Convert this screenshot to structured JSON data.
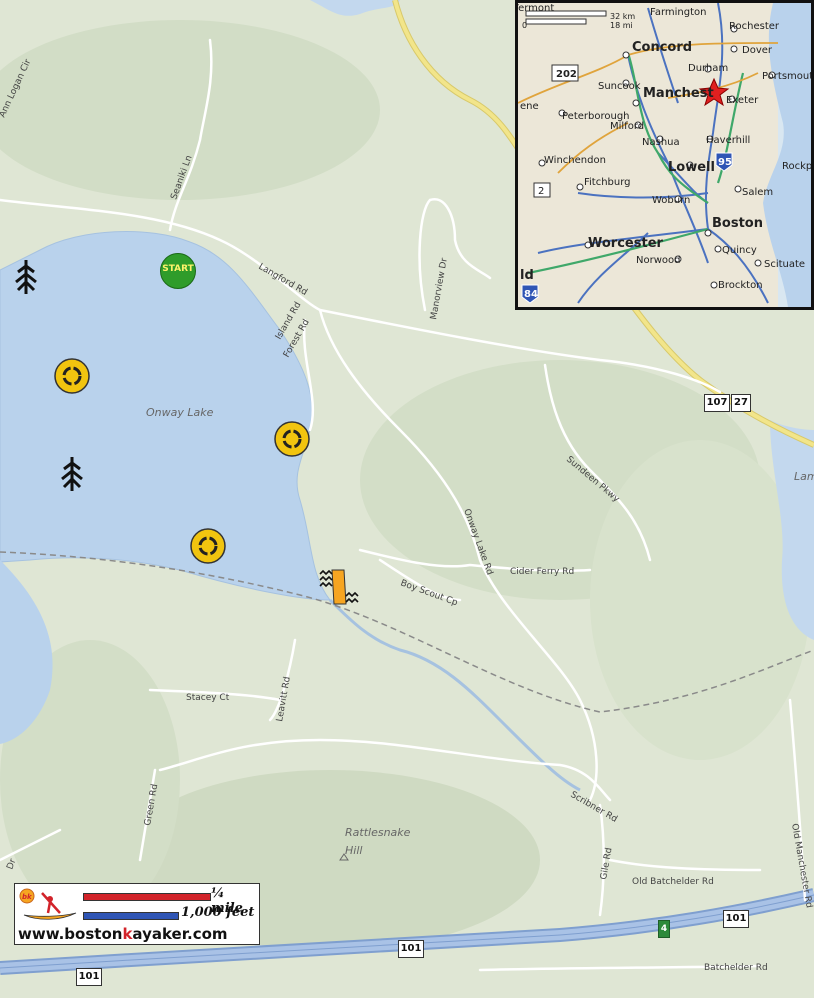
{
  "map": {
    "lake_name": "Onway Lake",
    "hill_name": "Rattlesnake Hill",
    "start_label": "START",
    "roads": {
      "ann_logan": "Ann Logan Cir",
      "seaniki": "Seaniki Ln",
      "langford": "Langford Rd",
      "island": "Island Rd",
      "forest": "Forest Rd",
      "manorview": "Manorview Dr",
      "sundeen": "Sundeen Pkwy",
      "onway_lake": "Onway Lake Rd",
      "cider_ferry": "Cider Ferry Rd",
      "boy_scout": "Boy Scout Cp",
      "stacey": "Stacey Ct",
      "leavitt": "Leavitt Rd",
      "green": "Green Rd",
      "scribner": "Scribner Rd",
      "gile": "Gile Rd",
      "old_batchelder": "Old Batchelder Rd",
      "batchelder": "Batchelder Rd",
      "old_manchester": "Old Manchester Rd",
      "lam": "Lam",
      "dr_left": "Dr"
    },
    "shields": {
      "rt107": "107",
      "rt27": "27",
      "rt101_a": "101",
      "rt101_b": "101",
      "rt101_c": "101",
      "exit4": "4"
    }
  },
  "inset": {
    "scale_km": "32 km",
    "scale_mi": "18 mi",
    "scale_zero": "0",
    "cities": {
      "farmington": "Farmington",
      "rochester": "Rochester",
      "dover": "Dover",
      "concord": "Concord",
      "durham": "Durham",
      "portsmouth": "Portsmout",
      "suncook": "Suncook",
      "manchester": "Manchest",
      "exeter": "Exeter",
      "peterborough": "Peterborough",
      "milford": "Milford",
      "nashua": "Nashua",
      "haverhill": "Haverhill",
      "winchendon": "Winchendon",
      "lowell": "Lowell",
      "rockport": "Rockp",
      "fitchburg": "Fitchburg",
      "salem": "Salem",
      "woburn": "Woburn",
      "boston": "Boston",
      "worcester": "Worcester",
      "quincy": "Quincy",
      "norwood": "Norwood",
      "scituate": "Scituate",
      "brockton": "Brockton",
      "vermont": "Vermont",
      "ene": "ene",
      "ld": "ld"
    },
    "shields": {
      "us202": "202",
      "i95": "95",
      "rt2": "2",
      "i84": "84"
    }
  },
  "legend": {
    "quarter_mile": "¼ mile",
    "thousand_feet": "1,000 feet",
    "url_pre": "www.boston",
    "url_k": "k",
    "url_mid": "ayaker",
    "url_post": ".com",
    "logo_badge": "bk"
  },
  "colors": {
    "water": "#b9d2ec",
    "land": "#dfe6d4",
    "forest_shade": "#cfdcc2",
    "road": "#ffffff",
    "highway": "#8fb0dc",
    "major_road": "#f2e58a",
    "start_marker": "#2f9c2a",
    "rapid_marker": "#f6a521",
    "bar_quarter_mile": "#d2232a",
    "bar_thousand_feet": "#2f55b5"
  }
}
